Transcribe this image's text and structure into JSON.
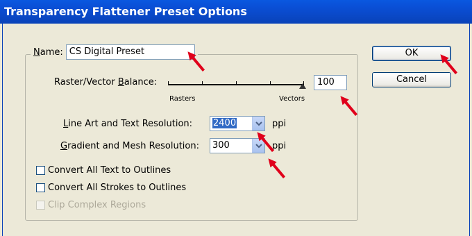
{
  "window": {
    "title": "Transparency Flattener Preset Options"
  },
  "name_field": {
    "label_accel": "N",
    "label_rest": "ame:",
    "value": "CS Digital Preset"
  },
  "balance": {
    "label_pre": "Raster/Vector ",
    "label_accel": "B",
    "label_post": "alance:",
    "left_label": "Rasters",
    "right_label": "Vectors",
    "value": "100",
    "level_percent": 100
  },
  "line_art": {
    "label_accel": "L",
    "label_rest": "ine Art and Text Resolution:",
    "value": "2400",
    "unit": "ppi"
  },
  "gradient": {
    "label_accel": "G",
    "label_rest": "radient and Mesh Resolution:",
    "value": "300",
    "unit": "ppi"
  },
  "checkboxes": [
    {
      "label": "Convert All Text to Outlines",
      "checked": false,
      "disabled": false
    },
    {
      "label": "Convert All Strokes to Outlines",
      "checked": false,
      "disabled": false
    },
    {
      "label": "Clip Complex Regions",
      "checked": false,
      "disabled": true
    }
  ],
  "buttons": {
    "ok": "OK",
    "cancel": "Cancel"
  },
  "colors": {
    "title_bar": "#0a4fd6",
    "arrow": "#e0001b",
    "selection": "#316ac5"
  }
}
